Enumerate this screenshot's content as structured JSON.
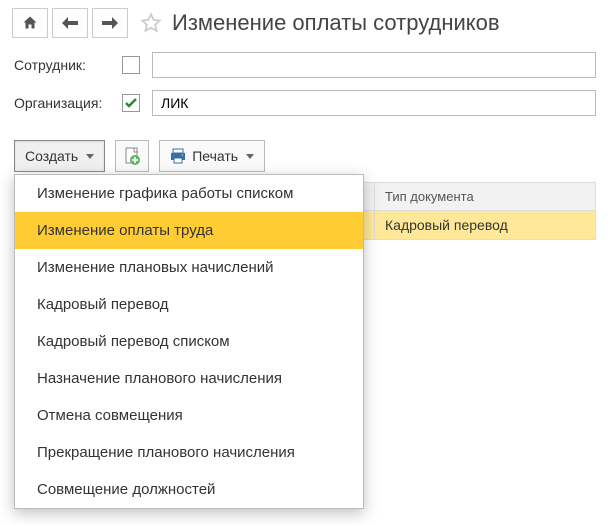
{
  "header": {
    "title": "Изменение оплаты сотрудников"
  },
  "form": {
    "employee_label": "Сотрудник:",
    "employee_value": "",
    "org_label": "Организация:",
    "org_value": "ЛИК"
  },
  "actions": {
    "create_label": "Создать",
    "print_label": "Печать"
  },
  "dropdown": {
    "items": [
      "Изменение графика работы списком",
      "Изменение оплаты труда",
      "Изменение плановых начислений",
      "Кадровый перевод",
      "Кадровый перевод списком",
      "Назначение планового начисления",
      "Отмена совмещения",
      "Прекращение планового начисления",
      "Совмещение должностей"
    ],
    "selected_index": 1
  },
  "table": {
    "headers": [
      "Тип документа"
    ],
    "rows": [
      {
        "doc_type": "Кадровый перевод"
      }
    ]
  }
}
